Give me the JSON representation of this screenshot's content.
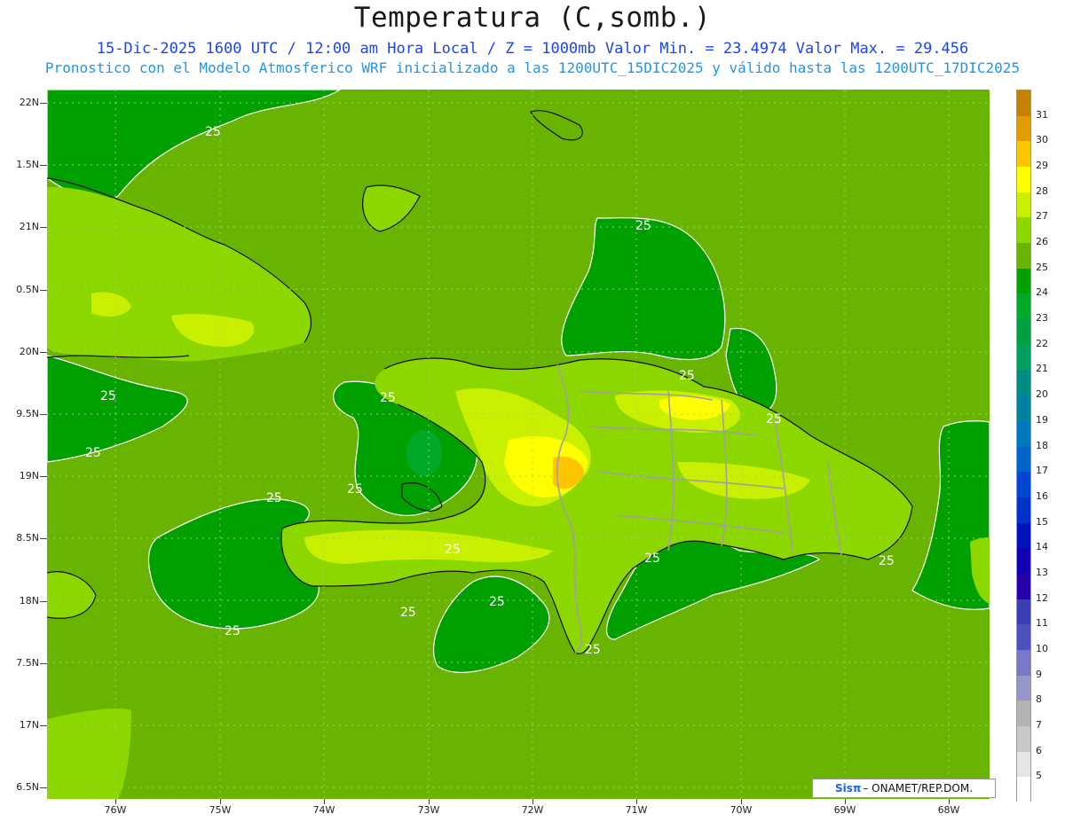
{
  "title": "Temperatura (C,somb.)",
  "subtitle_line1": "15-Dic-2025 1600 UTC / 12:00 am Hora Local / Z = 1000mb   Valor Min. = 23.4974  Valor Max. = 29.456",
  "subtitle_line2": "Pronostico con el Modelo Atmosferico WRF inicializado a las 1200UTC_15DIC2025 y válido hasta las  1200UTC_17DIC2025",
  "lat_labels": [
    "22N",
    "1.5N",
    "21N",
    "0.5N",
    "20N",
    "9.5N",
    "19N",
    "8.5N",
    "18N",
    "7.5N",
    "17N",
    "6.5N"
  ],
  "lon_labels": [
    "76W",
    "75W",
    "74W",
    "73W",
    "72W",
    "71W",
    "70W",
    "69W",
    "68W"
  ],
  "contour_labels": [
    "25",
    "25",
    "25",
    "25",
    "25",
    "25",
    "25",
    "25",
    "25",
    "25",
    "25",
    "25",
    "25",
    "25",
    "25",
    "25"
  ],
  "colorbar": {
    "labels": [
      "31",
      "30",
      "29",
      "28",
      "27",
      "26",
      "25",
      "24",
      "23",
      "22",
      "21",
      "20",
      "19",
      "18",
      "17",
      "16",
      "15",
      "14",
      "13",
      "12",
      "11",
      "10",
      "9",
      "8",
      "7",
      "6",
      "5"
    ],
    "colors": [
      "#c48200",
      "#e39b00",
      "#ffc400",
      "#ffff00",
      "#c8f000",
      "#8cd700",
      "#69b400",
      "#00a000",
      "#00aa28",
      "#00a040",
      "#00a064",
      "#008c82",
      "#0082a0",
      "#0078be",
      "#0064c8",
      "#0046d2",
      "#0032c8",
      "#0014be",
      "#1400b4",
      "#2800aa",
      "#3c3cb4",
      "#5050be",
      "#7878c8",
      "#9696c8",
      "#b4b4b4",
      "#c8c8c8",
      "#e6e6e6",
      "#ffffff"
    ]
  },
  "credit": {
    "sis": "Sisπ",
    "text": " – ONAMET/REP.DOM."
  },
  "colors": {
    "ocean": "#69b400",
    "cool": "#00a000",
    "land": "#8cd700",
    "warm": "#c8f000",
    "hot": "#ffff00",
    "peak": "#ffc400"
  }
}
